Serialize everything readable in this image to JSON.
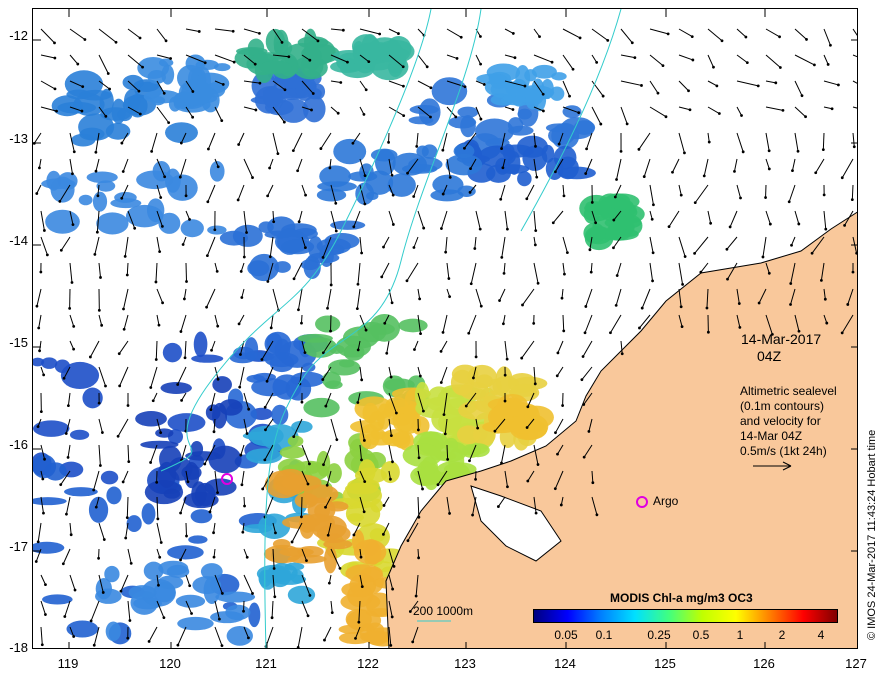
{
  "map": {
    "date": "14-Mar-2017",
    "time": "04Z",
    "legend_lines": [
      "Altimetric sealevel",
      "(0.1m contours)",
      "and velocity for",
      "14-Mar 04Z",
      "0.5m/s (1kt 24h)"
    ],
    "argo_label": "Argo",
    "depth_contours_label": "200  1000m",
    "credit": "© IMOS 24-Mar-2017 11:43:24 Hobart time",
    "land_color": "#f9c89b",
    "contour_color": "#33cccc",
    "argo_color": "#e000e0"
  },
  "axes": {
    "y_ticks": [
      "-12",
      "-13",
      "-14",
      "-15",
      "-16",
      "-17",
      "-18"
    ],
    "x_ticks": [
      "119",
      "120",
      "121",
      "122",
      "123",
      "124",
      "125",
      "126",
      "127"
    ]
  },
  "colorbar": {
    "title": "MODIS Chl-a mg/m3 OC3",
    "ticks": [
      "0.05",
      "0.1",
      "0.25",
      "0.5",
      "1",
      "2",
      "4"
    ],
    "colors": [
      "#00007f",
      "#0000ff",
      "#0080ff",
      "#00e0ff",
      "#40ff80",
      "#c0ff00",
      "#ffff00",
      "#ff8000",
      "#ff0000",
      "#800000"
    ]
  }
}
